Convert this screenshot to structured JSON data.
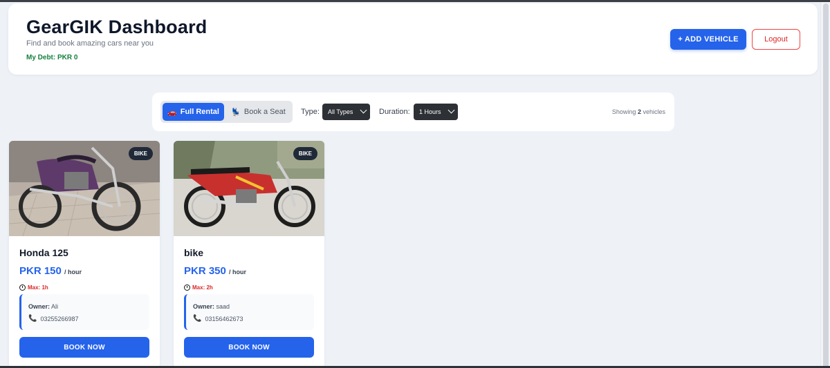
{
  "header": {
    "title": "GearGIK Dashboard",
    "subtitle": "Find and book amazing cars near you",
    "debt": "My Debt: PKR 0",
    "add_vehicle_label": "+ ADD VEHICLE",
    "logout_label": "Logout"
  },
  "filters": {
    "modes": [
      {
        "label": "Full Rental",
        "icon": "car-icon",
        "active": true
      },
      {
        "label": "Book a Seat",
        "icon": "seat-icon",
        "active": false
      }
    ],
    "type_label": "Type:",
    "type_value": "All Types",
    "duration_label": "Duration:",
    "duration_value": "1 Hours",
    "showing_prefix": "Showing",
    "showing_count": "2",
    "showing_suffix": "vehicles"
  },
  "vehicles": [
    {
      "badge": "BIKE",
      "name": "Honda 125",
      "price": "PKR 150",
      "per": "/ hour",
      "max": "Max: 1h",
      "owner_label": "Owner:",
      "owner": "Ali",
      "phone": "03255266987",
      "book_label": "BOOK NOW",
      "photo_color": "#6b5a7a"
    },
    {
      "badge": "BIKE",
      "name": "bike",
      "price": "PKR 350",
      "per": "/ hour",
      "max": "Max: 2h",
      "owner_label": "Owner:",
      "owner": "saad",
      "phone": "03156462673",
      "book_label": "BOOK NOW",
      "photo_color": "#c8302e"
    }
  ],
  "colors": {
    "accent": "#2563eb",
    "danger": "#dc2626",
    "success": "#15803d",
    "dark_select": "#2d3136"
  }
}
